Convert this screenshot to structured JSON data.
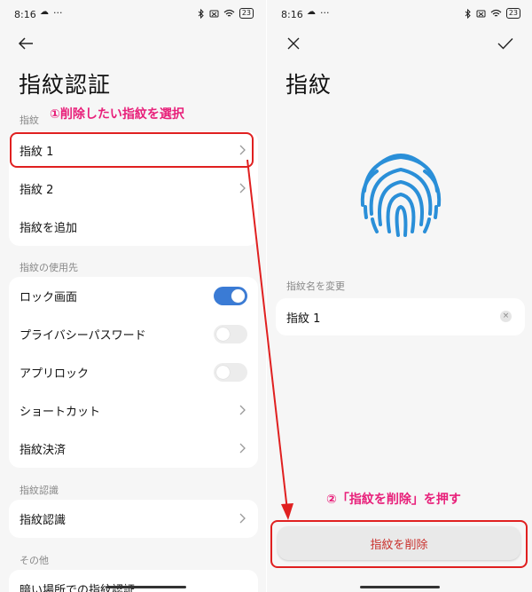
{
  "left_screen": {
    "status": {
      "time": "8:16",
      "cloud": "☁",
      "dots": "···",
      "battery": "23"
    },
    "title": "指紋認証",
    "sections": [
      {
        "label": "指紋",
        "items": [
          {
            "label": "指紋 1"
          },
          {
            "label": "指紋 2"
          },
          {
            "label": "指紋を追加"
          }
        ]
      },
      {
        "label": "指紋の使用先",
        "items": [
          {
            "label": "ロック画面",
            "toggle": true
          },
          {
            "label": "プライバシーパスワード",
            "toggle": false
          },
          {
            "label": "アプリロック",
            "toggle": false
          },
          {
            "label": "ショートカット"
          },
          {
            "label": "指紋決済"
          }
        ]
      },
      {
        "label": "指紋認識",
        "items": [
          {
            "label": "指紋認識"
          }
        ]
      },
      {
        "label": "その他",
        "items": [
          {
            "label": "暗い場所での指紋認証"
          }
        ]
      }
    ]
  },
  "right_screen": {
    "status": {
      "time": "8:16",
      "cloud": "☁",
      "dots": "···",
      "battery": "23"
    },
    "title": "指紋",
    "rename_label": "指紋名を変更",
    "fingerprint_name": "指紋 1",
    "clear_icon": "×",
    "delete_button": "指紋を削除"
  },
  "annotations": {
    "step1": "①削除したい指紋を選択",
    "step2": "②「指紋を削除」を押す"
  },
  "colors": {
    "accent": "#3a7bd5",
    "annotation": "#e8207a",
    "highlight": "#e02020",
    "fingerprint": "#2a8fd8",
    "delete_text": "#c9302c"
  }
}
